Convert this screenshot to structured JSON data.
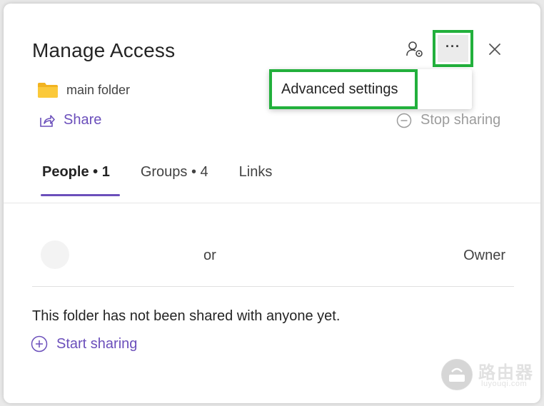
{
  "dialog": {
    "title": "Manage Access",
    "more_label": "···",
    "folder_name": "main folder"
  },
  "menu": {
    "advanced_settings": "Advanced settings"
  },
  "actions": {
    "share": "Share",
    "stop_sharing": "Stop sharing",
    "start_sharing": "Start sharing"
  },
  "tabs": [
    {
      "label": "People • 1",
      "active": true
    },
    {
      "label": "Groups • 4",
      "active": false
    },
    {
      "label": "Links",
      "active": false
    }
  ],
  "people": [
    {
      "name_visible": "or",
      "role": "Owner"
    }
  ],
  "empty_message": "This folder has not been shared with anyone yet.",
  "watermark": {
    "title": "路由器",
    "subtitle": "luyouqi.com"
  },
  "icons": {
    "people_settings": "people-settings-icon",
    "more": "ellipsis-icon",
    "close": "close-icon",
    "folder": "folder-icon",
    "share": "share-icon",
    "stop_sharing": "minus-circle-icon",
    "start_sharing": "plus-circle-icon"
  },
  "colors": {
    "accent": "#6b4fbb",
    "highlight": "#22b03c",
    "folder": "#f8c33a"
  }
}
